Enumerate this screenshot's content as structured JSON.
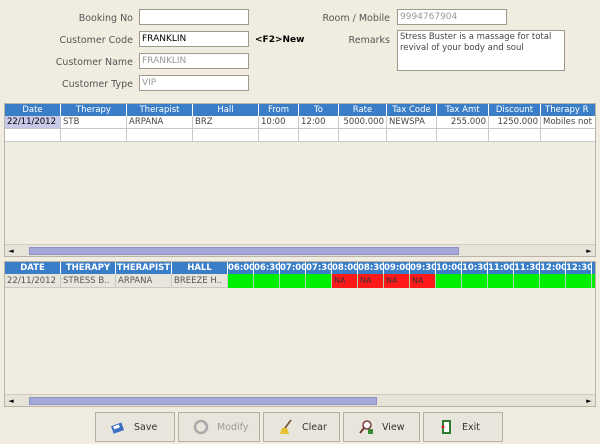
{
  "form": {
    "booking_no_label": "Booking No",
    "booking_no_value": "",
    "customer_code_label": "Customer Code",
    "customer_code_value": "FRANKLIN",
    "customer_code_hint": "<F2>New",
    "customer_name_label": "Customer Name",
    "customer_name_value": "FRANKLIN",
    "customer_type_label": "Customer Type",
    "customer_type_value": "VIP",
    "room_mobile_label": "Room / Mobile",
    "room_mobile_value": "9994767904",
    "remarks_label": "Remarks",
    "remarks_value": "Stress Buster is a massage for total revival of your body and soul"
  },
  "booking_grid": {
    "columns": [
      "Date",
      "Therapy",
      "Therapist",
      "Hall",
      "From",
      "To",
      "Rate",
      "Tax Code",
      "Tax Amt",
      "Discount",
      "Therapy R"
    ],
    "rows": [
      [
        "22/11/2012",
        "STB",
        "ARPANA",
        "BRZ",
        "10:00",
        "12:00",
        "5000.000",
        "NEWSPA",
        "255.000",
        "1250.000",
        "Mobiles not a"
      ]
    ]
  },
  "schedule_grid": {
    "columns": [
      "DATE",
      "THERAPY",
      "THERAPIST",
      "HALL"
    ],
    "time_slots": [
      "06:00",
      "06:30",
      "07:00",
      "07:30",
      "08:00",
      "08:30",
      "09:00",
      "09:30",
      "10:00",
      "10:30",
      "11:00",
      "11:30",
      "12:00",
      "12:30",
      "1"
    ],
    "row": {
      "date": "22/11/2012",
      "therapy": "STRESS B..",
      "therapist": "ARPANA",
      "hall": "BREEZE H..",
      "slot_status": [
        "free",
        "free",
        "free",
        "free",
        "NA",
        "NA",
        "NA",
        "NA",
        "free",
        "free",
        "free",
        "free",
        "free",
        "free",
        "free"
      ]
    },
    "colors": {
      "free": "#00ee00",
      "na": "#ff1a1a"
    }
  },
  "toolbar": {
    "save": "Save",
    "modify": "Modify",
    "clear": "Clear",
    "view": "View",
    "exit": "Exit"
  }
}
